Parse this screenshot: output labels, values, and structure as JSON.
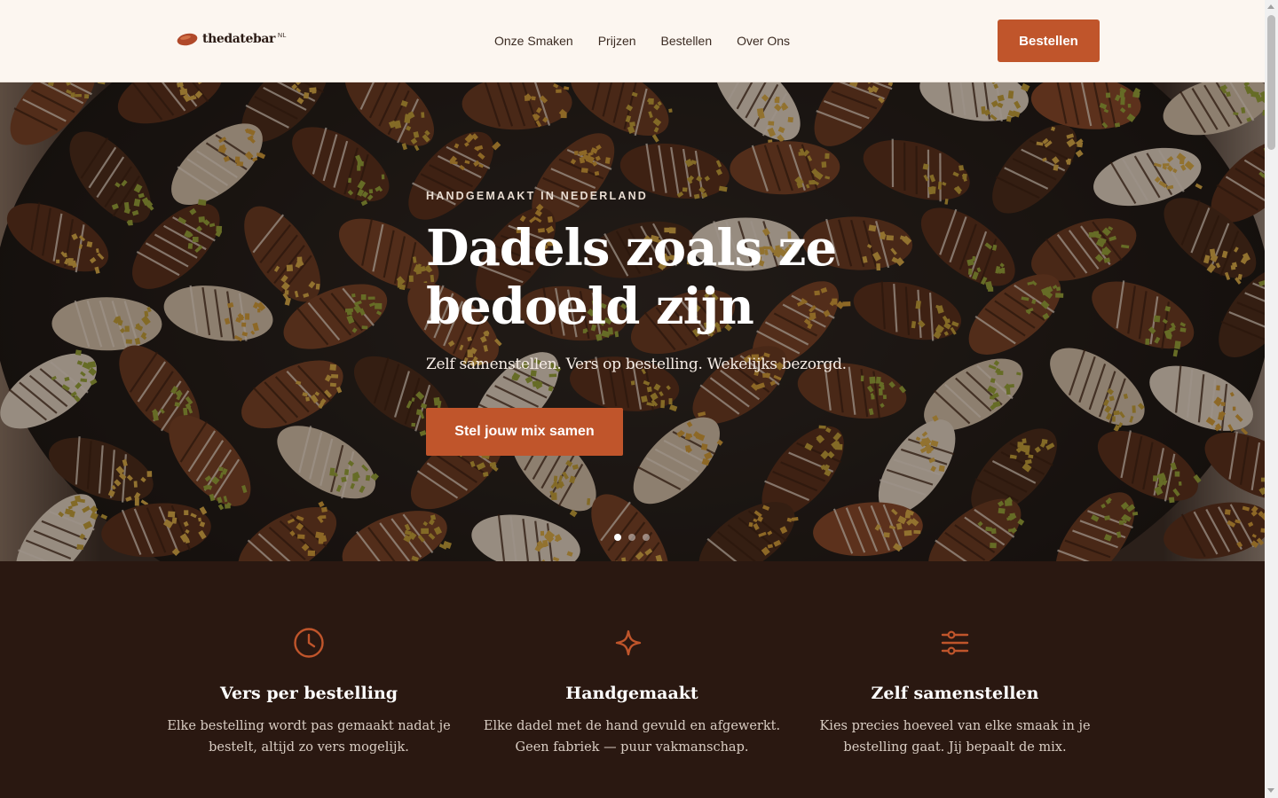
{
  "header": {
    "logo_text": "thedatebar",
    "logo_superscript": "NL",
    "nav": [
      "Onze Smaken",
      "Prijzen",
      "Bestellen",
      "Over Ons"
    ],
    "cta_label": "Bestellen"
  },
  "hero": {
    "eyebrow": "HANDGEMAAKT IN NEDERLAND",
    "title": "Dadels zoals ze bedoeld zijn",
    "subtitle": "Zelf samenstellen. Vers op bestelling. Wekelijks bezorgd.",
    "cta_label": "Stel jouw mix samen",
    "slides": {
      "count": 3,
      "active_index": 0
    }
  },
  "features": [
    {
      "icon": "clock-icon",
      "title": "Vers per bestelling",
      "text": "Elke bestelling wordt pas gemaakt nadat je bestelt, altijd zo vers mogelijk."
    },
    {
      "icon": "sparkle-icon",
      "title": "Handgemaakt",
      "text": "Elke dadel met de hand gevuld en afgewerkt. Geen fabriek — puur vakmanschap."
    },
    {
      "icon": "sliders-icon",
      "title": "Zelf samenstellen",
      "text": "Kies precies hoeveel van elke smaak in je bestelling gaat. Jij bepaalt de mix."
    }
  ],
  "colors": {
    "accent": "#c0552b",
    "header_bg": "#fcf6f0",
    "dark_bg": "#2a1811"
  }
}
